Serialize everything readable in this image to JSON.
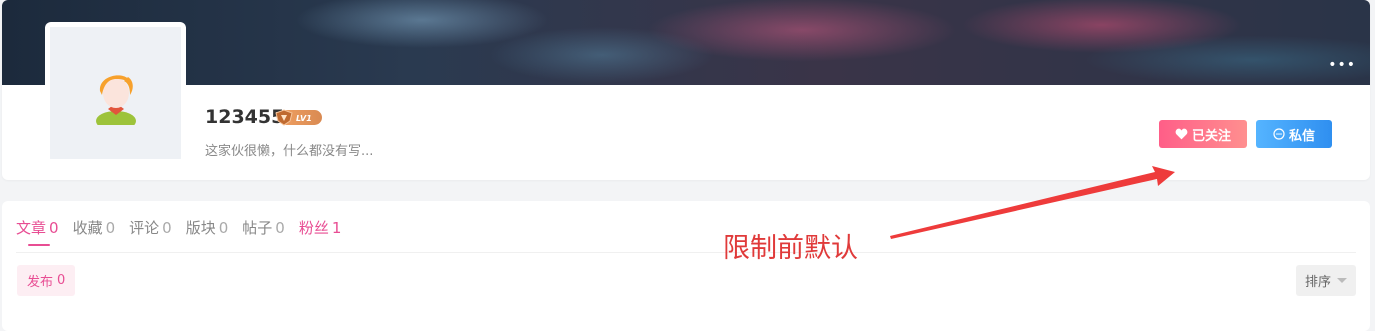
{
  "profile": {
    "username": "123455",
    "level_badge": "LV1",
    "bio": "这家伙很懒，什么都没有写...",
    "follow_button": "已关注",
    "message_button": "私信",
    "icons": [
      "more-icon",
      "heart-icon",
      "chat-bubble-icon",
      "avatar-placeholder-icon",
      "level-badge-icon"
    ]
  },
  "tabs": [
    {
      "label": "文章",
      "count": "0"
    },
    {
      "label": "收藏",
      "count": "0"
    },
    {
      "label": "评论",
      "count": "0"
    },
    {
      "label": "版块",
      "count": "0"
    },
    {
      "label": "帖子",
      "count": "0"
    },
    {
      "label": "粉丝",
      "count": "1"
    }
  ],
  "subfilter": {
    "label": "发布",
    "count": "0"
  },
  "sort": {
    "label": "排序"
  },
  "annotation": {
    "text": "限制前默认",
    "color": "#e03a3a"
  },
  "colors": {
    "accent": "#e84d93",
    "follow": "#ff6b8b",
    "message": "#3a9bf5"
  }
}
